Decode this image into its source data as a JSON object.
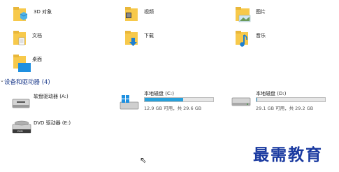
{
  "folders": [
    {
      "label": "3D 对象",
      "icon": "3d-objects-folder-icon"
    },
    {
      "label": "视频",
      "icon": "videos-folder-icon"
    },
    {
      "label": "图片",
      "icon": "pictures-folder-icon"
    },
    {
      "label": "文档",
      "icon": "documents-folder-icon"
    },
    {
      "label": "下载",
      "icon": "downloads-folder-icon"
    },
    {
      "label": "音乐",
      "icon": "music-folder-icon"
    },
    {
      "label": "桌面",
      "icon": "desktop-folder-icon"
    }
  ],
  "devices_section": {
    "title": "设备和驱动器 (4)"
  },
  "drives": [
    {
      "label": "软盘驱动器 (A:)",
      "icon": "floppy-drive-icon"
    },
    {
      "label": "本地磁盘 (C:)",
      "free_text": "12.9 GB 可用，共 29.6 GB",
      "used_fraction": 0.564,
      "icon": "windows-drive-icon"
    },
    {
      "label": "本地磁盘 (D:)",
      "free_text": "29.1 GB 可用，共 29.2 GB",
      "used_fraction": 0.003,
      "icon": "hard-drive-icon"
    },
    {
      "label": "DVD 驱动器 (E:)",
      "icon": "dvd-drive-icon"
    }
  ],
  "watermark": "最需教育",
  "colors": {
    "folder": "#f7c94b",
    "accent": "#26a0da",
    "section_title": "#1e3c8c",
    "watermark": "#1a3aa0"
  }
}
